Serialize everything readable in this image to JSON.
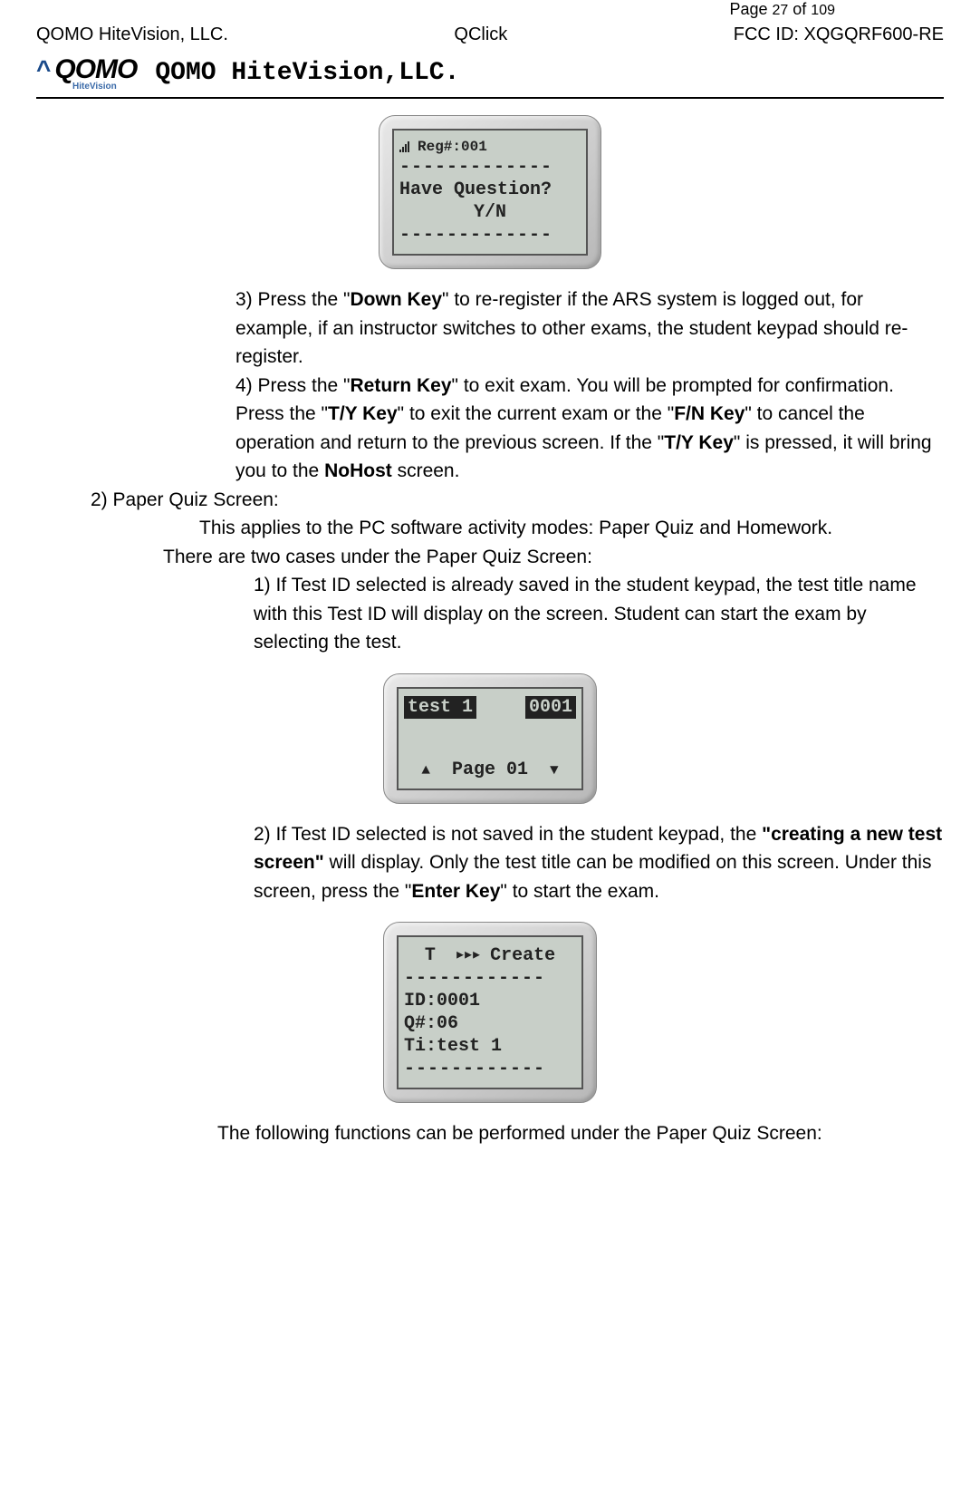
{
  "header": {
    "page_prefix": "Page ",
    "page_current": "27",
    "page_of": " of ",
    "page_total": "109",
    "left": "QOMO HiteVision, LLC.",
    "center": "QClick",
    "right": "FCC ID: XQGQRF600-RE"
  },
  "logo": {
    "caret": "^",
    "main": "QOMO",
    "sub": "HiteVision"
  },
  "title": "QOMO HiteVision,LLC.",
  "fig1": {
    "reg": "Reg#:001",
    "dashes": "-------------",
    "q": "Have Question?",
    "yn": "Y/N"
  },
  "p3a": "3) Press the \"",
  "p3b": "Down Key",
  "p3c": "\" to re-register if the ARS system is logged out, for example, if an instructor switches to other exams, the student keypad should re-register.",
  "p4a": "4) Press the \"",
  "p4b": "Return Key",
  "p4c": "\" to exit exam. You will be prompted for confirmation. Press the \"",
  "p4d": "T/Y Key",
  "p4e": "\" to exit the current exam or the \"",
  "p4f": "F/N Key",
  "p4g": "\" to cancel the operation and return to the previous screen. If the \"",
  "p4h": "T/Y Key",
  "p4i": "\" is pressed, it will bring you to the ",
  "p4j": "NoHost",
  "p4k": " screen.",
  "sec2_label": "2)   Paper Quiz Screen:",
  "sec2_p1": "This applies to the PC software activity modes: Paper Quiz and Homework.",
  "sec2_p2": "There are two cases under the Paper Quiz Screen:",
  "case1": "1) If Test ID selected is already saved in the student keypad, the test title name with this Test ID will display on the screen. Student can start the exam by selecting the test.",
  "fig2": {
    "test": "test 1",
    "id": "0001",
    "page_prefix": "Page ",
    "page_num": "01"
  },
  "case2a": "2) If Test ID selected is not saved in the student keypad, the ",
  "case2b": "\"creating a new test screen\"",
  "case2c": " will display. Only the test title can be modified on this screen. Under this screen, press the \"",
  "case2d": "Enter Key",
  "case2e": "\" to start the exam.",
  "fig3": {
    "top_t": "T",
    "top_create": "Create",
    "dashes": "------------",
    "id": "ID:0001",
    "q": "Q#:06",
    "ti": "Ti:test 1"
  },
  "footer_line": "The following functions can be performed under the Paper Quiz Screen:"
}
